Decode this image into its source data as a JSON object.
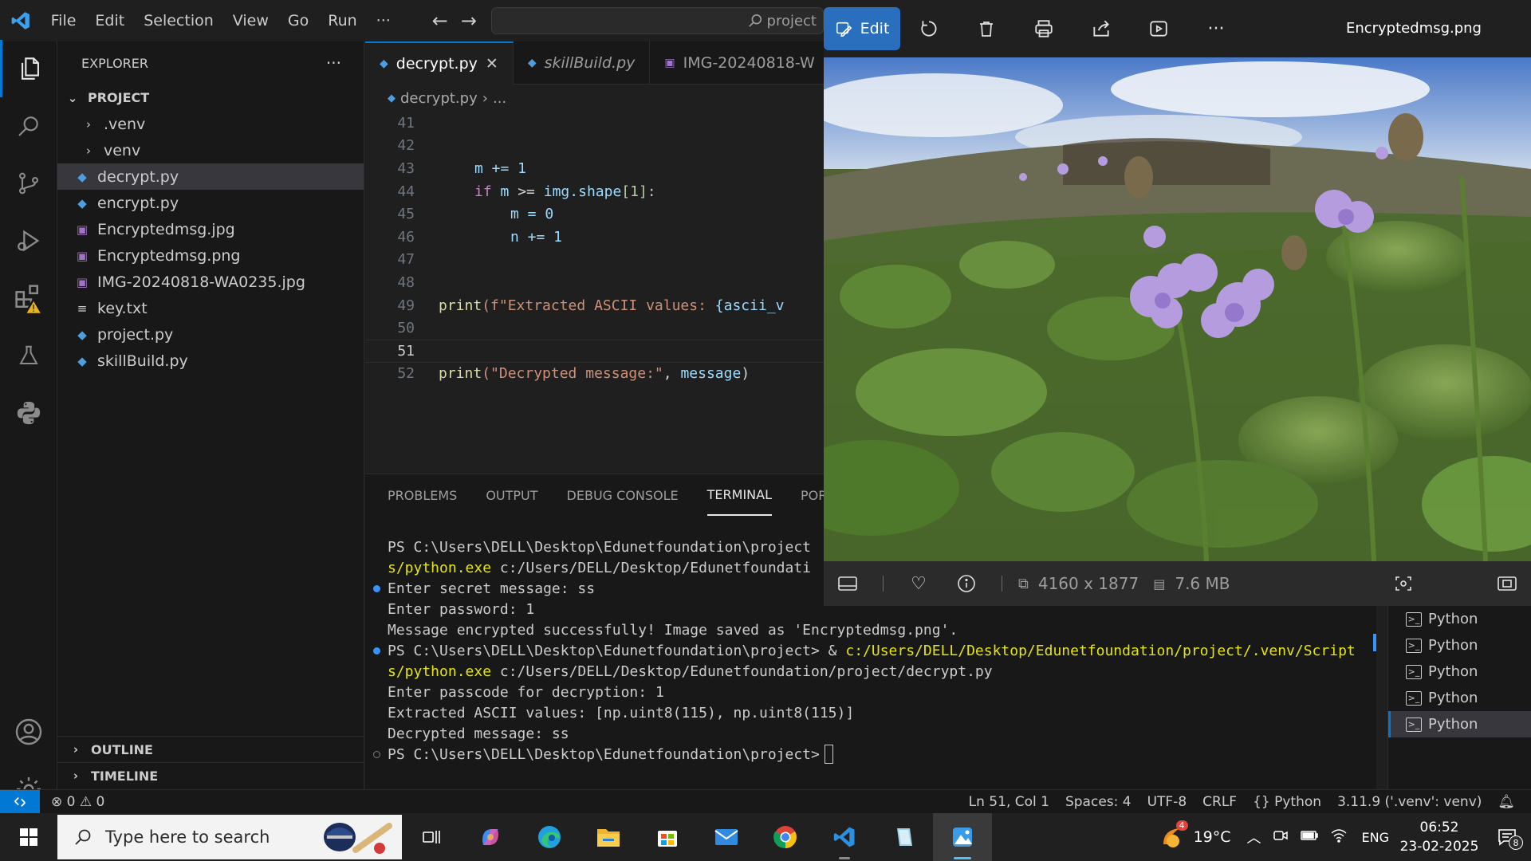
{
  "vscode": {
    "menu": [
      "File",
      "Edit",
      "Selection",
      "View",
      "Go",
      "Run",
      "···"
    ],
    "command_center": "project",
    "explorer": {
      "title": "EXPLORER",
      "more": "···",
      "project_label": "PROJECT",
      "items": [
        {
          "label": ".venv",
          "type": "folder"
        },
        {
          "label": "venv",
          "type": "folder"
        },
        {
          "label": "decrypt.py",
          "type": "python",
          "selected": true
        },
        {
          "label": "encrypt.py",
          "type": "python"
        },
        {
          "label": "Encryptedmsg.jpg",
          "type": "image"
        },
        {
          "label": "Encryptedmsg.png",
          "type": "image"
        },
        {
          "label": "IMG-20240818-WA0235.jpg",
          "type": "image"
        },
        {
          "label": "key.txt",
          "type": "text"
        },
        {
          "label": "project.py",
          "type": "python"
        },
        {
          "label": "skillBuild.py",
          "type": "python"
        }
      ],
      "outline_label": "OUTLINE",
      "timeline_label": "TIMELINE"
    },
    "tabs": [
      {
        "label": "decrypt.py",
        "active": true
      },
      {
        "label": "skillBuild.py"
      },
      {
        "label": "IMG-20240818-W"
      }
    ],
    "breadcrumb": {
      "file": "decrypt.py",
      "rest": "..."
    },
    "code": {
      "lines": [
        {
          "n": "41"
        },
        {
          "n": "42"
        },
        {
          "n": "43"
        },
        {
          "n": "44"
        },
        {
          "n": "45"
        },
        {
          "n": "46"
        },
        {
          "n": "47"
        },
        {
          "n": "48"
        },
        {
          "n": "49"
        },
        {
          "n": "50"
        },
        {
          "n": "51"
        },
        {
          "n": "52"
        }
      ],
      "l43": "m += 1",
      "l44_kw": "if",
      "l44_a": "m",
      "l44_b": ">=",
      "l44_c": "img",
      "l44_d": ".shape",
      "l44_e": "[1]:",
      "l45": "m = 0",
      "l46": "n += 1",
      "l49_fn": "print",
      "l49_str": "(f\"Extracted ASCII values: ",
      "l49_var": "{ascii_v",
      "l52_fn": "print",
      "l52_str": "(\"Decrypted message:\"",
      "l52_sep": ", ",
      "l52_var": "message",
      "l52_end": ")"
    },
    "panel_tabs": [
      "PROBLEMS",
      "OUTPUT",
      "DEBUG CONSOLE",
      "TERMINAL",
      "PORTS"
    ],
    "terminal": {
      "l1": "PS C:\\Users\\DELL\\Desktop\\Edunetfoundation\\project",
      "l2_exe": "s/python.exe",
      "l2_rest": " c:/Users/DELL/Desktop/Edunetfoundati",
      "l3": "Enter secret message: ss",
      "l4": "Enter password: 1",
      "l5": "Message encrypted successfully! Image saved as 'Encryptedmsg.png'.",
      "l6_prompt": "PS C:\\Users\\DELL\\Desktop\\Edunetfoundation\\project> & ",
      "l6_path": "c:/Users/DELL/Desktop/Edunetfoundation/project/.venv/Script",
      "l7_exe": "s/python.exe",
      "l7_rest": " c:/Users/DELL/Desktop/Edunetfoundation/project/decrypt.py",
      "l8": "Enter passcode for decryption: 1",
      "l9": "Extracted ASCII values: [np.uint8(115), np.uint8(115)]",
      "l10": "Decrypted message: ss",
      "l11": "PS C:\\Users\\DELL\\Desktop\\Edunetfoundation\\project>"
    },
    "terminal_list": [
      "Python",
      "Python",
      "Python",
      "Python",
      "Python"
    ],
    "status": {
      "errors": "0",
      "warnings": "0",
      "position": "Ln 51, Col 1",
      "spaces": "Spaces: 4",
      "encoding": "UTF-8",
      "eol": "CRLF",
      "language": "Python",
      "interpreter": "3.11.9 ('.venv': venv)"
    }
  },
  "photos": {
    "edit_label": "Edit",
    "title": "Encryptedmsg.png",
    "more": "···",
    "dimensions": "4160 x 1877",
    "size": "7.6 MB"
  },
  "taskbar": {
    "search_placeholder": "Type here to search",
    "weather_badge": "4",
    "temperature": "19°C",
    "language": "ENG",
    "time": "06:52",
    "date": "23-02-2025",
    "notifications": "8"
  },
  "colors": {
    "accent": "#0078d4",
    "edit_button": "#2a6fbd",
    "flower": "#a78bdc"
  }
}
